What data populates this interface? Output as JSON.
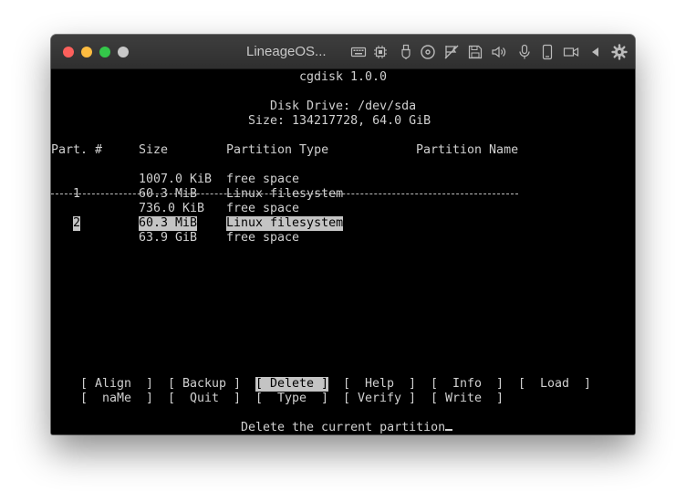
{
  "window": {
    "title": "LineageOS...",
    "toolbar_icons": [
      "keyboard-icon",
      "cpu-icon",
      "usb-icon",
      "cd-icon",
      "network-icon",
      "floppy-save-icon",
      "speaker-icon",
      "microphone-icon",
      "phone-icon",
      "camera-icon",
      "back-arrow-icon",
      "gear-icon"
    ]
  },
  "terminal": {
    "app_title": "cgdisk 1.0.0",
    "disk_drive": "Disk Drive: /dev/sda",
    "size_line": "Size: 134217728, 64.0 GiB",
    "headers": {
      "part": "Part. #",
      "size": "Size",
      "type": "Partition Type",
      "name": "Partition Name"
    },
    "rows": [
      {
        "part": "",
        "size": "1007.0 KiB",
        "type": "free space",
        "selected": false
      },
      {
        "part": "1",
        "size": "60.3 MiB",
        "type": "Linux filesystem",
        "selected": false
      },
      {
        "part": "",
        "size": "736.0 KiB",
        "type": "free space",
        "selected": false
      },
      {
        "part": "2",
        "size": "60.3 MiB",
        "type": "Linux filesystem",
        "selected": true
      },
      {
        "part": "",
        "size": "63.9 GiB",
        "type": "free space",
        "selected": false
      }
    ],
    "menu_row1": {
      "align": "[ Align  ]",
      "backup": "[ Backup ]",
      "delete": "[ Delete ]",
      "help": "[  Help  ]",
      "info": "[  Info  ]",
      "load": "[  Load  ]"
    },
    "menu_row2": {
      "name": "[  naMe  ]",
      "quit": "[  Quit  ]",
      "type": "[  Type  ]",
      "verify": "[ Verify ]",
      "write": "[ Write  ]"
    },
    "status": "Delete the current partition"
  }
}
